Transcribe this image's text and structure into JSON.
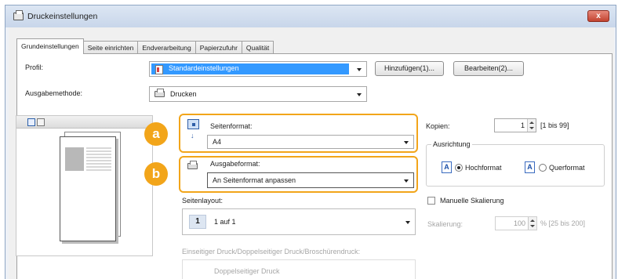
{
  "window": {
    "title": "Druckeinstellungen",
    "close_label": "x"
  },
  "tabs": [
    {
      "label": "Grundeinstellungen",
      "active": true
    },
    {
      "label": "Seite einrichten",
      "active": false
    },
    {
      "label": "Endverarbeitung",
      "active": false
    },
    {
      "label": "Papierzufuhr",
      "active": false
    },
    {
      "label": "Qualität",
      "active": false
    }
  ],
  "profile": {
    "label": "Profil:",
    "value": "Standardeinstellungen",
    "add_button": "Hinzufügen(1)...",
    "edit_button": "Bearbeiten(2)..."
  },
  "output_method": {
    "label": "Ausgabemethode:",
    "value": "Drucken"
  },
  "page_format": {
    "badge": "a",
    "label": "Seitenformat:",
    "value": "A4"
  },
  "output_format": {
    "badge": "b",
    "label": "Ausgabeformat:",
    "value": "An Seitenformat anpassen"
  },
  "page_layout": {
    "label": "Seitenlayout:",
    "number": "1",
    "value": "1 auf 1"
  },
  "duplex": {
    "label": "Einseitiger Druck/Doppelseitiger Druck/Broschürendruck:",
    "value": "Doppelseitiger Druck"
  },
  "copies": {
    "label": "Kopien:",
    "value": "1",
    "range": "[1 bis 99]"
  },
  "orientation": {
    "group_label": "Ausrichtung",
    "portrait_icon": "A",
    "portrait_label": "Hochformat",
    "landscape_icon": "A",
    "landscape_label": "Querformat",
    "selected": "portrait"
  },
  "manual_scaling": {
    "label": "Manuelle Skalierung",
    "checked": false
  },
  "scaling": {
    "label": "Skalierung:",
    "value": "100",
    "range": "% [25 bis 200]"
  },
  "colors": {
    "highlight": "#f2a51a",
    "selection": "#3399ff",
    "close": "#c24330"
  }
}
